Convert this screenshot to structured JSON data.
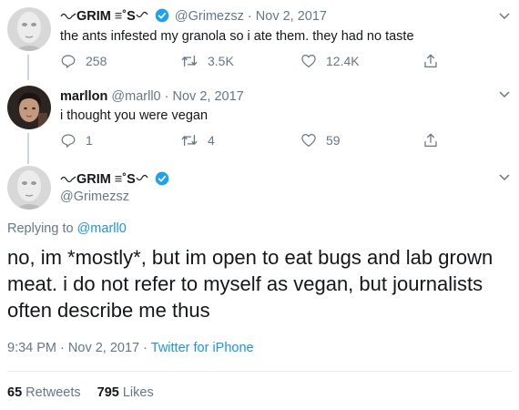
{
  "tweet1": {
    "author_name": "GRIM ≡˚S",
    "handle": "@Grimezsz",
    "separator": "·",
    "date": "Nov 2, 2017",
    "text": "the ants infested my granola so i ate them.  they had no taste",
    "replies": "258",
    "retweets": "3.5K",
    "likes": "12.4K"
  },
  "tweet2": {
    "author_name": "marllon",
    "handle": "@marll0",
    "separator": "·",
    "date": "Nov 2, 2017",
    "text": "i thought you were vegan",
    "replies": "1",
    "retweets": "4",
    "likes": "59"
  },
  "main_tweet": {
    "author_name": "GRIM ≡˚S",
    "handle": "@Grimezsz",
    "replying_prefix": "Replying to",
    "replying_to": "@marll0",
    "text": "no, im *mostly*, but im open to eat bugs and lab grown meat.  i do not refer to myself as vegan, but journalists often describe me thus",
    "time": "9:34 PM",
    "separator": "·",
    "date": "Nov 2, 2017",
    "source": "Twitter for iPhone",
    "retweets_count": "65",
    "retweets_label": "Retweets",
    "likes_count": "795",
    "likes_label": "Likes"
  },
  "icons": {
    "verified": "verified-badge-icon",
    "reply": "reply-icon",
    "retweet": "retweet-icon",
    "like": "heart-icon",
    "share": "share-icon",
    "more": "chevron-down-icon"
  },
  "colors": {
    "link": "#1b95e0",
    "verified": "#1da1f2",
    "secondary_text": "#657786",
    "thread_line": "#ccd6dd"
  }
}
